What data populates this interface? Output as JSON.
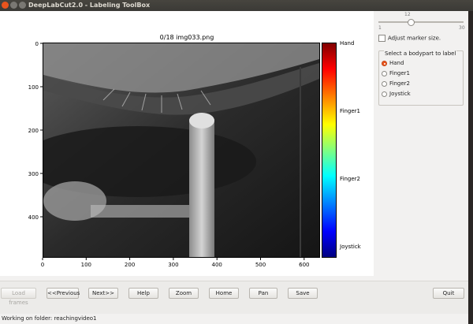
{
  "window": {
    "title": "DeepLabCut2.0 - Labeling ToolBox"
  },
  "plot": {
    "title": "0/18 img033.png",
    "x_ticks": [
      "0",
      "100",
      "200",
      "300",
      "400",
      "500",
      "600"
    ],
    "y_ticks": [
      "0",
      "100",
      "200",
      "300",
      "400"
    ],
    "colorbar_labels": [
      "Hand",
      "Finger1",
      "Finger2",
      "Joystick"
    ]
  },
  "controls": {
    "slider": {
      "min": "1",
      "max": "30",
      "value": "12",
      "fraction": 0.38
    },
    "adjust_marker_label": "Adjust marker size.",
    "adjust_marker_checked": false,
    "bodypart_group_title": "Select a bodypart to label",
    "bodyparts": [
      {
        "label": "Hand",
        "selected": true
      },
      {
        "label": "Finger1",
        "selected": false
      },
      {
        "label": "Finger2",
        "selected": false
      },
      {
        "label": "Joystick",
        "selected": false
      }
    ]
  },
  "buttons": {
    "load_frames": "Load frames",
    "previous": "<<Previous",
    "next": "Next>>",
    "help": "Help",
    "zoom": "Zoom",
    "home": "Home",
    "pan": "Pan",
    "save": "Save",
    "quit": "Quit"
  },
  "status": {
    "text": "Working on folder: reachingvideo1"
  },
  "colors": {
    "accent": "#e9541d",
    "titlebar": "#3b3a36",
    "window_bg": "#f2f1f0"
  }
}
